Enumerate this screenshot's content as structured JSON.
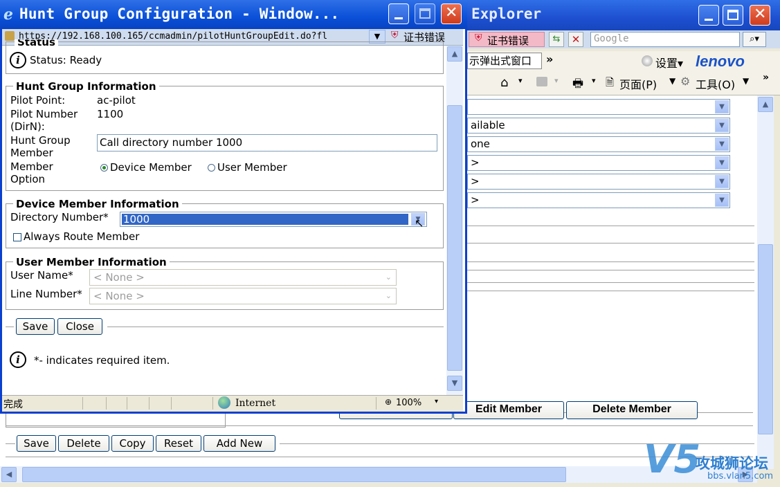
{
  "background_window": {
    "title_fragment": "Explorer",
    "cert_error": "证书错误",
    "search_placeholder": "Google",
    "toolbar": {
      "popup_item": "示弹出式窗口",
      "more": "»",
      "settings": "设置▾",
      "brand": "lenovo",
      "page_menu": "页面(P)",
      "tools_menu": "工具(O)"
    },
    "selects": [
      "",
      "ailable",
      "one",
      ">",
      ">",
      ">"
    ],
    "buttons": {
      "edit_member": "Edit Member",
      "delete_member": "Delete Member",
      "save": "Save",
      "delete": "Delete",
      "copy": "Copy",
      "reset": "Reset",
      "add_new": "Add New"
    }
  },
  "popup": {
    "title": "Hunt Group Configuration - Window...",
    "url": "https://192.168.100.165/ccmadmin/pilotHuntGroupEdit.do?fl",
    "cert_error": "证书错误",
    "status_section": {
      "legend": "Status",
      "text": "Status: Ready"
    },
    "hunt_group_info": {
      "legend": "Hunt Group Information",
      "pilot_point_label": "Pilot Point:",
      "pilot_point_value": "ac-pilot",
      "pilot_number_label": "Pilot Number",
      "pilot_number_label2": "(DirN):",
      "pilot_number_value": "1100",
      "member_label": "Hunt Group",
      "member_label2": "Member",
      "member_value": "Call directory number 1000",
      "option_label": "Member",
      "option_label2": "Option",
      "option_device": "Device Member",
      "option_user": "User Member"
    },
    "device_member_info": {
      "legend": "Device Member Information",
      "dir_number_label": "Directory Number*",
      "dir_number_value": "1000",
      "always_route": "Always Route Member"
    },
    "user_member_info": {
      "legend": "User Member Information",
      "user_name_label": "User Name*",
      "user_name_value": "< None >",
      "line_number_label": "Line Number*",
      "line_number_value": "< None >"
    },
    "buttons": {
      "save": "Save",
      "close": "Close"
    },
    "required_note": "*- indicates required item.",
    "statusbar": {
      "done": "完成",
      "zone": "Internet",
      "zoom": "100%"
    }
  },
  "watermark": {
    "logo": "V5",
    "cn": "攻城狮论坛",
    "url": "bbs.vlan5.com"
  },
  "colors": {
    "titlebar": "#0a50d8",
    "selection": "#3166c6",
    "close_button": "#cf3b1c"
  }
}
